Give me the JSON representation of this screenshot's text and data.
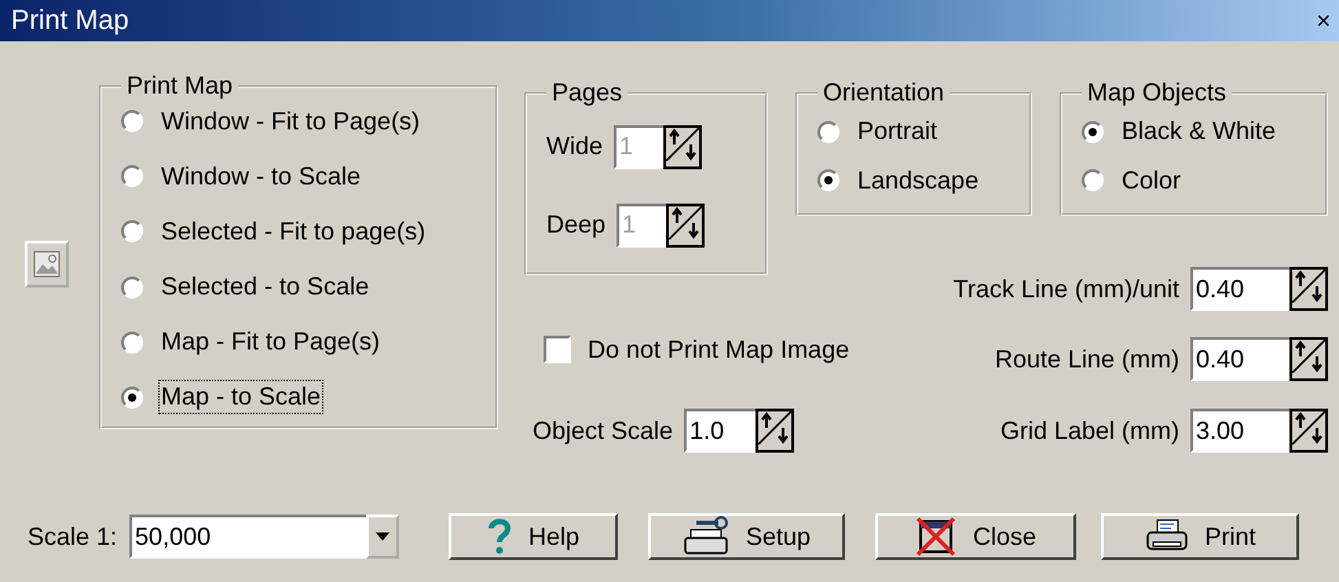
{
  "window": {
    "title": "Print Map",
    "close": "×"
  },
  "print_map": {
    "label": "Print Map",
    "options": [
      {
        "label": "Window - Fit to Page(s)",
        "selected": false,
        "focused": false
      },
      {
        "label": "Window - to Scale",
        "selected": false,
        "focused": false
      },
      {
        "label": "Selected - Fit to page(s)",
        "selected": false,
        "focused": false
      },
      {
        "label": "Selected - to Scale",
        "selected": false,
        "focused": false
      },
      {
        "label": "Map - Fit to Page(s)",
        "selected": false,
        "focused": false
      },
      {
        "label": "Map - to Scale",
        "selected": true,
        "focused": true
      }
    ]
  },
  "pages": {
    "label": "Pages",
    "fields": [
      {
        "label": "Wide",
        "value": "1",
        "disabled": true
      },
      {
        "label": "Deep",
        "value": "1",
        "disabled": true
      }
    ]
  },
  "orientation": {
    "label": "Orientation",
    "options": [
      {
        "label": "Portrait",
        "selected": false
      },
      {
        "label": "Landscape",
        "selected": true
      }
    ]
  },
  "map_objects": {
    "label": "Map Objects",
    "options": [
      {
        "label": "Black & White",
        "selected": true
      },
      {
        "label": "Color",
        "selected": false
      }
    ]
  },
  "line_fields": [
    {
      "label": "Track Line (mm)/unit",
      "value": "0.40"
    },
    {
      "label": "Route Line (mm)",
      "value": "0.40"
    },
    {
      "label": "Grid Label (mm)",
      "value": "3.00"
    }
  ],
  "no_image": {
    "label": "Do not Print Map Image",
    "checked": false
  },
  "object_scale": {
    "label": "Object Scale",
    "value": "1.0"
  },
  "scale": {
    "label": "Scale 1:",
    "value": "50,000"
  },
  "buttons": [
    {
      "label": "Help",
      "kind": "help"
    },
    {
      "label": "Setup",
      "kind": "setup"
    },
    {
      "label": "Close",
      "kind": "close"
    },
    {
      "label": "Print",
      "kind": "print"
    }
  ]
}
